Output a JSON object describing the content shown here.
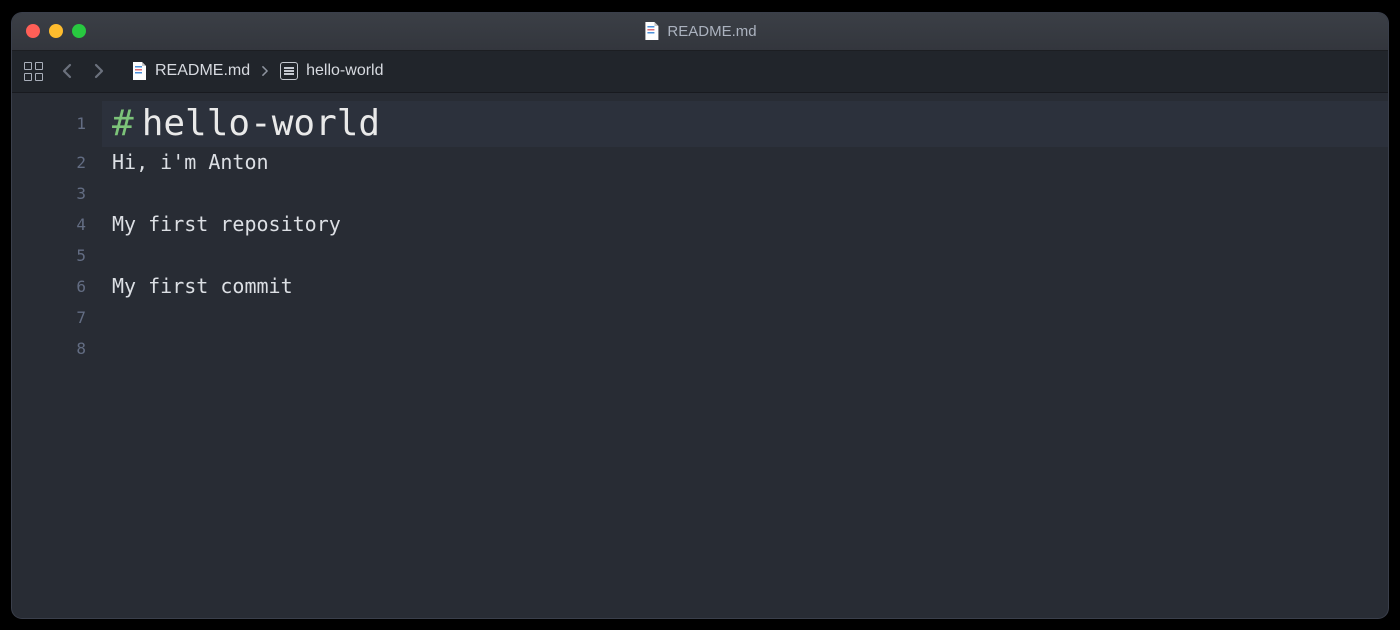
{
  "window": {
    "title": "README.md"
  },
  "breadcrumbs": {
    "file": "README.md",
    "section": "hello-world"
  },
  "editor": {
    "lines": [
      {
        "num": "1",
        "hash": "#",
        "heading": "hello-world"
      },
      {
        "num": "2",
        "text": "Hi, i'm Anton"
      },
      {
        "num": "3",
        "text": ""
      },
      {
        "num": "4",
        "text": "My first repository"
      },
      {
        "num": "5",
        "text": ""
      },
      {
        "num": "6",
        "text": "My first commit"
      },
      {
        "num": "7",
        "text": ""
      },
      {
        "num": "8",
        "text": ""
      }
    ]
  }
}
